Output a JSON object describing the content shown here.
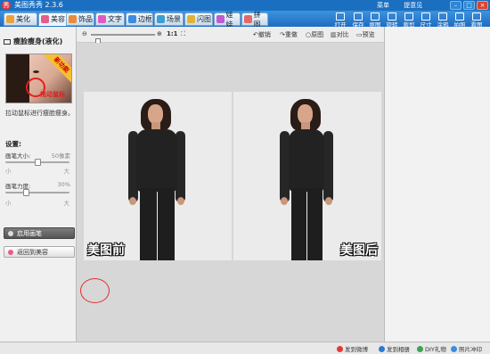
{
  "app": {
    "title": "美图秀秀 2.3.6",
    "links": [
      "菜单",
      "提意见"
    ],
    "win_buttons": [
      "–",
      "□",
      "×"
    ]
  },
  "tabs": [
    {
      "label": "美化",
      "color": "#e9a23b"
    },
    {
      "label": "美容",
      "color": "#e65d8a"
    },
    {
      "label": "饰品",
      "color": "#e98c3a"
    },
    {
      "label": "文字",
      "color": "#e05bc0"
    },
    {
      "label": "边框",
      "color": "#3a8de0"
    },
    {
      "label": "场景",
      "color": "#3aa0d0"
    },
    {
      "label": "闪图",
      "color": "#e0b23a"
    },
    {
      "label": "娃娃",
      "color": "#c05ad0"
    },
    {
      "label": "拼图",
      "color": "#e06a6a"
    }
  ],
  "toolbar": [
    "打开",
    "保存",
    "抠图",
    "旋转",
    "裁剪",
    "尺寸",
    "涂鸦",
    "拍照",
    "看图"
  ],
  "left_panel": {
    "title": "瘦脸瘦身(液化)",
    "thumb_ribbon": "新功能",
    "thumb_drag": "拖动鼠标",
    "description": "拉动鼠标进行瘦脸瘦身。",
    "settings_label": "设置:",
    "brush_size": {
      "label": "画笔大小:",
      "value_text": "50像素",
      "min": "小",
      "max": "大",
      "level": 0.5
    },
    "brush_strength": {
      "label": "画笔力度:",
      "value_text": "30%",
      "min": "小",
      "max": "大",
      "level": 0.3
    },
    "enable_brush": "启用画笔",
    "back_to_beauty": "返回到美容"
  },
  "canvas_bar": {
    "ratio": "1:1",
    "undo": "撤销",
    "redo": "重做",
    "original": "原图",
    "compare": "对比",
    "preview": "预览",
    "zoom_level": 0.08
  },
  "photos": [
    {
      "label": "美图前"
    },
    {
      "label": "美图后"
    }
  ],
  "status_bar": [
    "发到微博",
    "发到相册",
    "DIY礼物",
    "照片冲印"
  ]
}
